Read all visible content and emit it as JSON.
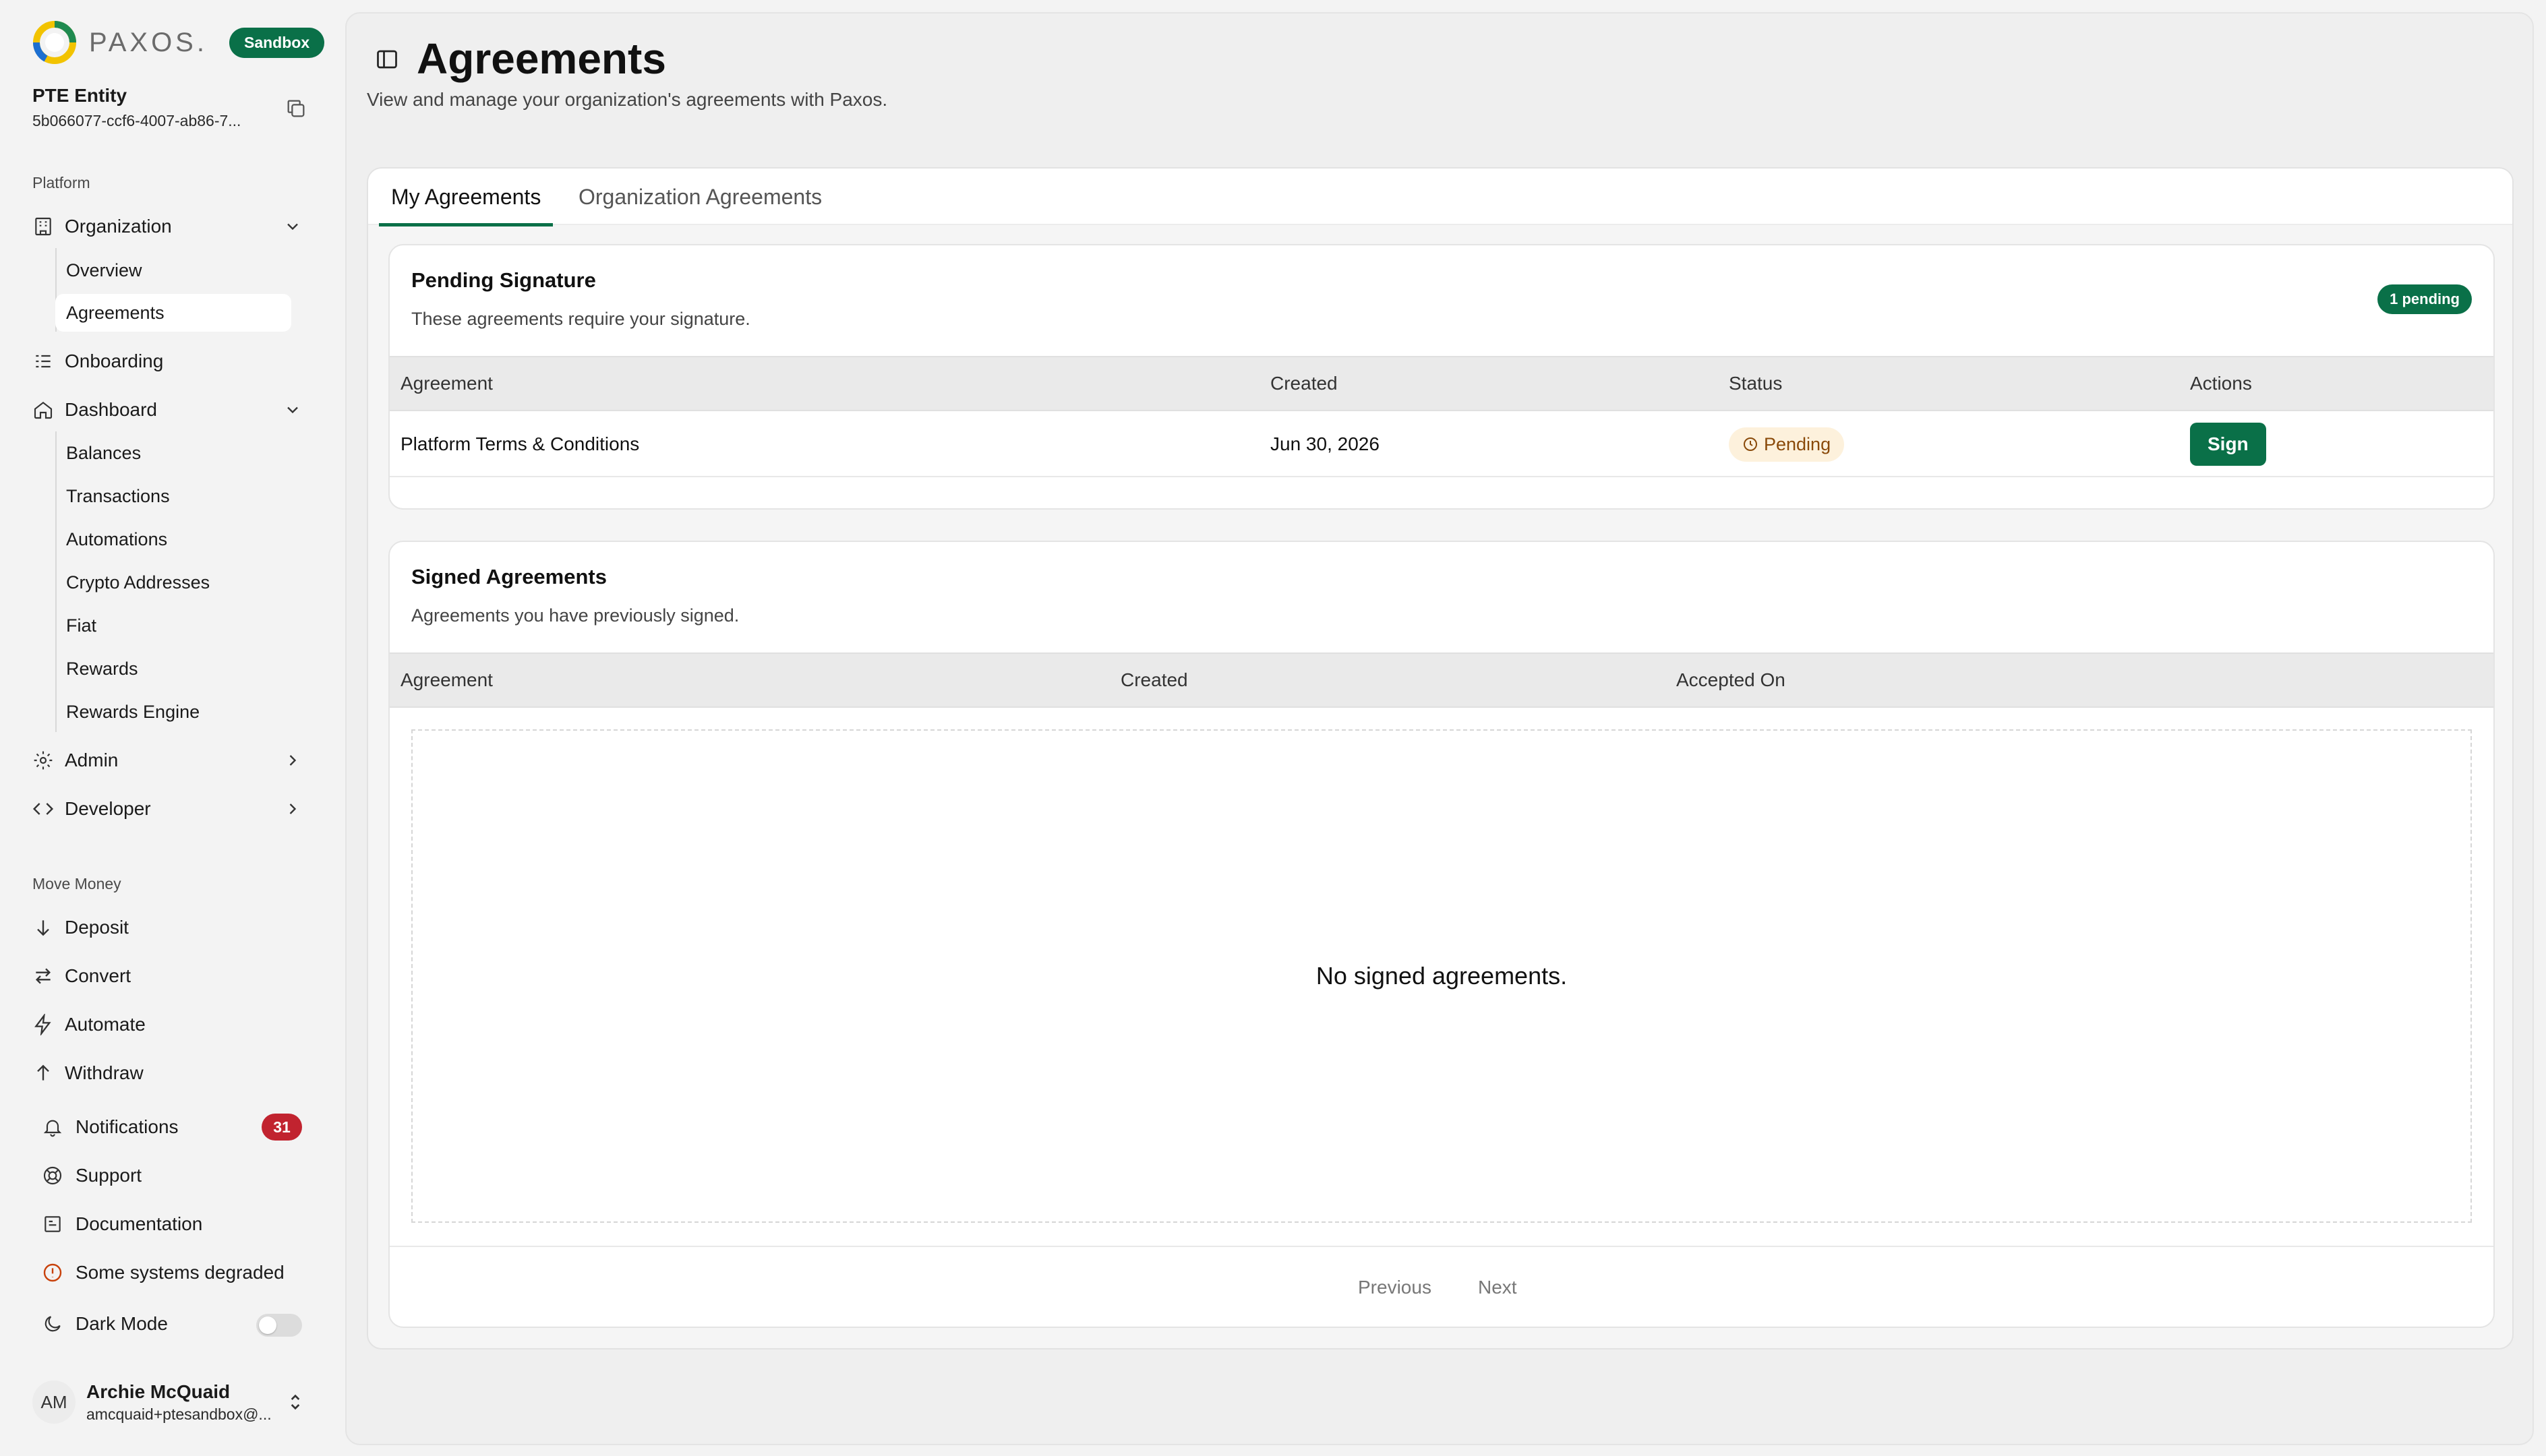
{
  "brand": {
    "name": "PAXOS.",
    "env_badge": "Sandbox"
  },
  "entity": {
    "name": "PTE Entity",
    "id": "5b066077-ccf6-4007-ab86-7..."
  },
  "sidebar": {
    "platform_label": "Platform",
    "organization": {
      "label": "Organization",
      "children": [
        "Overview",
        "Agreements"
      ]
    },
    "onboarding": "Onboarding",
    "dashboard": {
      "label": "Dashboard",
      "children": [
        "Balances",
        "Transactions",
        "Automations",
        "Crypto Addresses",
        "Fiat",
        "Rewards",
        "Rewards Engine"
      ]
    },
    "admin": "Admin",
    "developer": "Developer",
    "move_money_label": "Move Money",
    "move_money": [
      "Deposit",
      "Convert",
      "Automate",
      "Withdraw"
    ],
    "notifications": {
      "label": "Notifications",
      "count": "31"
    },
    "support": "Support",
    "documentation": "Documentation",
    "system_status": "Some systems degraded",
    "dark_mode": {
      "label": "Dark Mode",
      "enabled": false
    }
  },
  "user": {
    "initials": "AM",
    "name": "Archie McQuaid",
    "email": "amcquaid+ptesandbox@..."
  },
  "page": {
    "title": "Agreements",
    "subtitle": "View and manage your organization's agreements with Paxos."
  },
  "tabs": [
    "My Agreements",
    "Organization Agreements"
  ],
  "pending": {
    "title": "Pending Signature",
    "description": "These agreements require your signature.",
    "badge": "1 pending",
    "columns": [
      "Agreement",
      "Created",
      "Status",
      "Actions"
    ],
    "rows": [
      {
        "agreement": "Platform Terms & Conditions",
        "created": "Jun 30, 2026",
        "status": "Pending",
        "action": "Sign"
      }
    ]
  },
  "signed": {
    "title": "Signed Agreements",
    "description": "Agreements you have previously signed.",
    "columns": [
      "Agreement",
      "Created",
      "Accepted On"
    ],
    "empty_text": "No signed agreements.",
    "pager": {
      "previous": "Previous",
      "next": "Next"
    }
  },
  "colors": {
    "accent": "#0a7048",
    "badge_red": "#c1232f",
    "pending_bg": "#fdf1dc",
    "pending_text": "#8a4a0a"
  }
}
